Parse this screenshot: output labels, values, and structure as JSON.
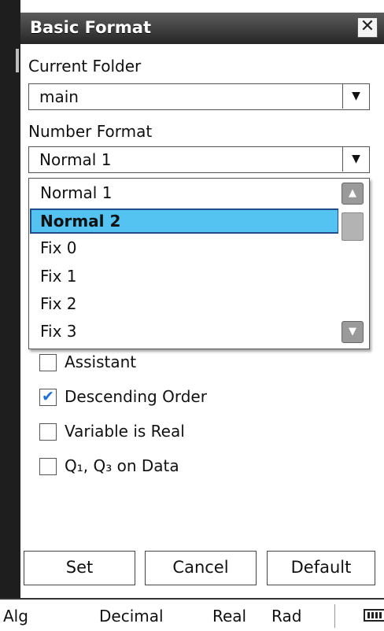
{
  "dialog": {
    "title": "Basic Format",
    "close_glyph": "✕"
  },
  "current_folder": {
    "label": "Current Folder",
    "value": "main",
    "arrow": "▼"
  },
  "number_format": {
    "label": "Number Format",
    "value": "Normal 1",
    "arrow": "▼",
    "options": [
      "Normal 1",
      "Normal 2",
      "Fix 0",
      "Fix 1",
      "Fix 2",
      "Fix 3"
    ],
    "highlighted": "Normal 2",
    "scroll_up": "▲",
    "scroll_down": "▼"
  },
  "checkboxes": [
    {
      "label": "Assistant",
      "checked": false
    },
    {
      "label": "Descending Order",
      "checked": true
    },
    {
      "label": "Variable is Real",
      "checked": false
    },
    {
      "label": "Q₁, Q₃ on Data",
      "checked": false
    }
  ],
  "check_mark": "✔",
  "buttons": {
    "set": "Set",
    "cancel": "Cancel",
    "default": "Default"
  },
  "status_bar": {
    "mode": "Alg",
    "display": "Decimal",
    "complex": "Real",
    "angle": "Rad",
    "battery_icon": "battery-icon"
  }
}
